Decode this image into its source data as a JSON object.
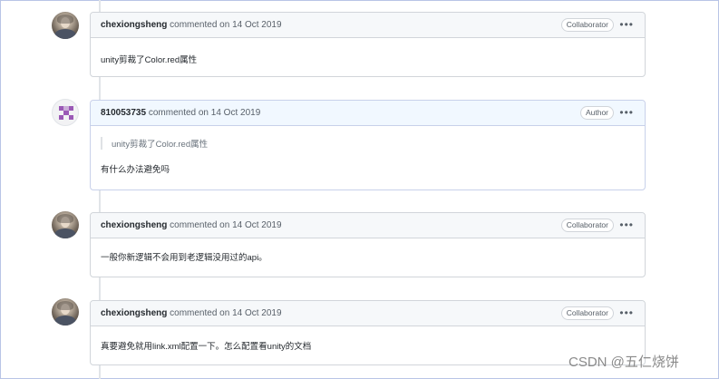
{
  "comments": [
    {
      "username": "chexiongsheng",
      "meta": "commented on 14 Oct 2019",
      "badge": "Collaborator",
      "menu": "•••",
      "quote": "",
      "body": "unity剪裁了Color.red属性"
    },
    {
      "username": "810053735",
      "meta": "commented on 14 Oct 2019",
      "badge": "Author",
      "menu": "•••",
      "quote": "unity剪裁了Color.red属性",
      "body": "有什么办法避免吗"
    },
    {
      "username": "chexiongsheng",
      "meta": "commented on 14 Oct 2019",
      "badge": "Collaborator",
      "menu": "•••",
      "quote": "",
      "body": "一般你新逻辑不会用到老逻辑没用过的api。"
    },
    {
      "username": "chexiongsheng",
      "meta": "commented on 14 Oct 2019",
      "badge": "Collaborator",
      "menu": "•••",
      "quote": "",
      "body": "真要避免就用link.xml配置一下。怎么配置看unity的文档"
    }
  ],
  "watermark": "CSDN @五仁烧饼",
  "colors": {
    "identicon": "#9b59b6",
    "header_bg": "#f6f8fa",
    "author_header_bg": "#f1f8ff",
    "border": "#d1d5da",
    "frame": "#b8c4e6"
  }
}
